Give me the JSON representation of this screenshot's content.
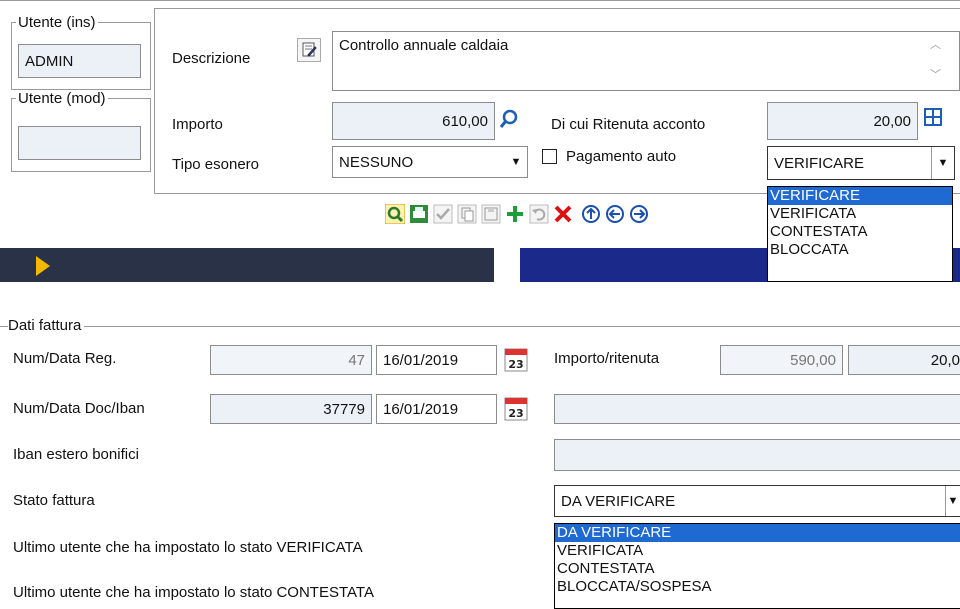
{
  "top_panel": {
    "user_ins": {
      "legend": "Utente (ins)",
      "value": "ADMIN"
    },
    "user_mod": {
      "legend": "Utente (mod)",
      "value": ""
    },
    "descrizione": {
      "label": "Descrizione",
      "value": "Controllo annuale caldaia"
    },
    "importo": {
      "label": "Importo",
      "value": "610,00"
    },
    "ritenuta": {
      "label": "Di cui Ritenuta acconto",
      "value": "20,00"
    },
    "tipo_esonero": {
      "label": "Tipo esonero",
      "value": "NESSUNO"
    },
    "pagamento_auto": {
      "label": "Pagamento auto",
      "checked": false
    },
    "stato": {
      "value": "VERIFICARE",
      "options": [
        "VERIFICARE",
        "VERIFICATA",
        "CONTESTATA",
        "BLOCCATA"
      ],
      "selected_index": 0
    },
    "toolbar_icons": [
      "search-icon",
      "print-icon",
      "confirm-icon",
      "copy-icon",
      "save-icon",
      "add-icon",
      "undo-icon",
      "delete-icon",
      "nav-up-icon",
      "nav-left-icon",
      "nav-right-icon"
    ]
  },
  "bottom_panel": {
    "legend": "Dati fattura",
    "num_data_reg": {
      "label": "Num/Data Reg.",
      "num": "47",
      "date": "16/01/2019"
    },
    "num_data_doc": {
      "label": "Num/Data Doc/Iban",
      "num": "37779",
      "date": "16/01/2019"
    },
    "importo_ritenuta": {
      "label": "Importo/ritenuta",
      "importo": "590,00",
      "ritenuta": "20,0"
    },
    "iban_estero": {
      "label": "Iban estero bonifici"
    },
    "stato_fattura": {
      "label": "Stato fattura",
      "value": "DA VERIFICARE",
      "options": [
        "DA VERIFICARE",
        "VERIFICATA",
        "CONTESTATA",
        "BLOCCATA/SOSPESA"
      ],
      "selected_index": 0
    },
    "ultimo_verificata": {
      "label": "Ultimo utente che ha impostato lo stato VERIFICATA"
    },
    "ultimo_contestata": {
      "label": "Ultimo utente che ha impostato lo stato CONTESTATA"
    },
    "calendar_day": "23"
  },
  "colors": {
    "selection": "#1e69d2",
    "field_bg": "#ecf1f8",
    "border": "#8c8c8c"
  }
}
